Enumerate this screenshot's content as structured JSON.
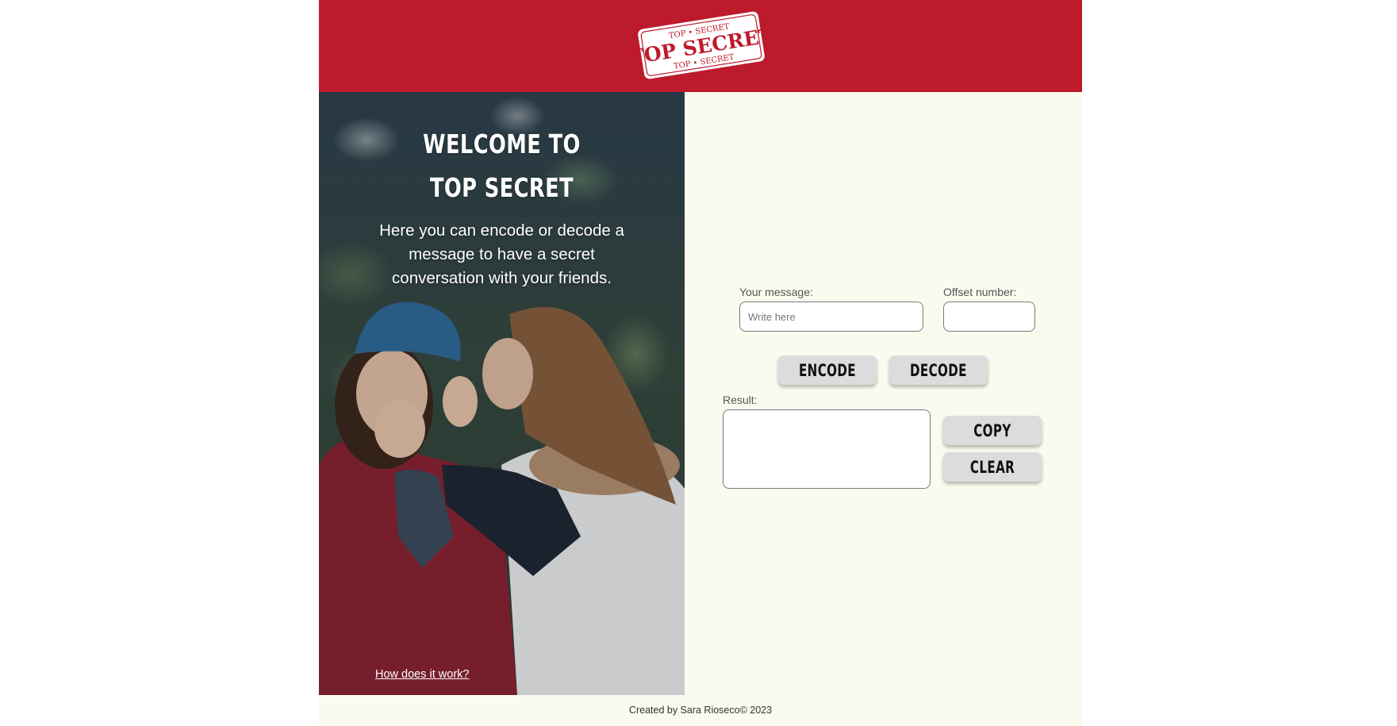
{
  "header": {
    "logo_lines": [
      "TOP • SECRET",
      "TOP SECRET",
      "TOP • SECRET"
    ],
    "background_color": "#bd1a2c"
  },
  "hero": {
    "title": "WELCOME TO TOP SECRET",
    "description": "Here you can encode or decode a message to have a secret conversation with your friends.",
    "link_text": "How does it work?"
  },
  "form": {
    "message_label": "Your message:",
    "message_placeholder": "Write here",
    "message_value": "",
    "offset_label": "Offset number:",
    "offset_value": "",
    "encode_label": "ENCODE",
    "decode_label": "DECODE",
    "result_label": "Result:",
    "result_value": "",
    "copy_label": "COPY",
    "clear_label": "CLEAR"
  },
  "footer": {
    "text": "Created by Sara Rioseco© 2023"
  }
}
